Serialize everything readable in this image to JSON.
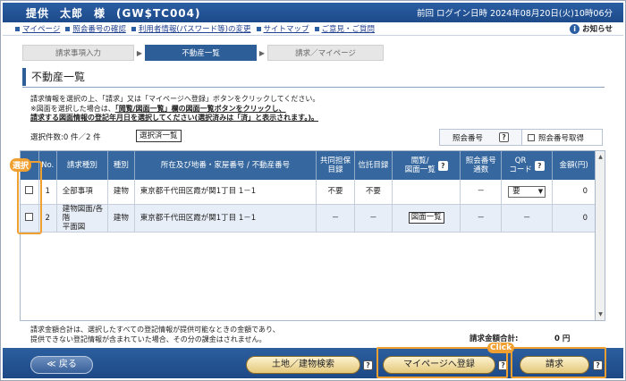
{
  "header": {
    "name_family": "提供",
    "name_given": "太郎",
    "honorific": "様",
    "user_id": "(GW$TC004)",
    "last_login": "前回 ログイン日時 2024年08月20日(火)10時06分"
  },
  "menu": {
    "items": [
      "マイページ",
      "照会番号の確認",
      "利用者情報(パスワード等)の変更",
      "サイトマップ",
      "ご意見・ご質問"
    ],
    "notice": "お知らせ"
  },
  "steps": [
    "請求事項入力",
    "不動産一覧",
    "請求／マイページ"
  ],
  "page_title": "不動産一覧",
  "instructions": {
    "line1": "請求情報を選択の上、「請求」又は「マイページへ登録」ボタンをクリックしてください。",
    "line2_prefix": "※図面を選択した場合は、",
    "line2_underlined": "「閲覧/図面一覧」欄の図面一覧ボタンをクリックし、",
    "line3": "請求する図面情報の登記年月日を選択してください(選択済みは「済」と表示されます。)。"
  },
  "selection_count": "選択件数:0 件／2 件",
  "selected_button": "選択済一覧",
  "shoukai": {
    "label": "照会番号",
    "checkbox_label": "照会番号取得"
  },
  "table": {
    "headers": {
      "no": "No.",
      "kind": "請求種別",
      "type": "種別",
      "location": "所在及び地番・家屋番号 / 不動産番号",
      "joint": [
        "共同担保",
        "目録"
      ],
      "trust": "信託目録",
      "view": [
        "閲覧/",
        "図面一覧"
      ],
      "shoukai_count": [
        "照会番号",
        "通数"
      ],
      "qr": [
        "QR",
        "コード"
      ],
      "amount": "金額(円)"
    },
    "rows": [
      {
        "no": "1",
        "kind": "全部事項",
        "type": "建物",
        "location": "東京都千代田区霞が関1丁目",
        "number": "1－1",
        "joint": "不要",
        "trust": "不要",
        "view": "",
        "count": "－",
        "qr": "要",
        "amount": "0"
      },
      {
        "no": "2",
        "kind_line1": "建物図面/各階",
        "kind_line2": "平面図",
        "type": "建物",
        "location": "東京都千代田区霞が関1丁目",
        "number": "1－1",
        "joint": "－",
        "trust": "－",
        "view_button": "図面一覧",
        "count": "－",
        "qr": "－",
        "amount": "0"
      }
    ]
  },
  "callouts": {
    "select": "選択",
    "click": "Click"
  },
  "notes": {
    "line1": "請求金額合計は、選択したすべての登記情報が提供可能なときの金額であり、",
    "line2": "提供できない登記情報が含まれていた場合、その分の課金はされません。"
  },
  "total": {
    "label": "請求金額合計:",
    "value": "0 円"
  },
  "footer": {
    "back": "≪ 戻る",
    "land_search": "土地／建物検索",
    "mypage": "マイページへ登録",
    "request": "請求"
  },
  "colors": {
    "header": "#1d4a8a",
    "accent": "#f0a030",
    "table_header": "#36689f"
  }
}
